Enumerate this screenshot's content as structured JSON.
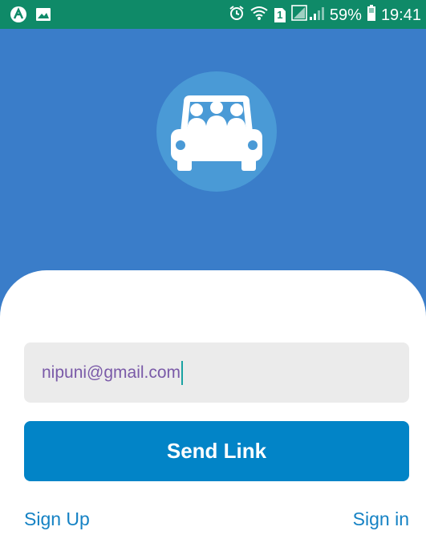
{
  "status_bar": {
    "battery_percent": "59%",
    "time": "19:41",
    "sim_label": "1",
    "icons": [
      "app-icon",
      "image-icon",
      "alarm-icon",
      "wifi-icon",
      "sim-icon",
      "signal-icon",
      "battery-icon"
    ]
  },
  "logo": {
    "icon": "carpool-car-icon"
  },
  "form": {
    "email_value": "nipuni@gmail.com",
    "send_label": "Send Link"
  },
  "links": {
    "sign_up": "Sign Up",
    "sign_in": "Sign in"
  },
  "colors": {
    "status_bar": "#0f8a68",
    "header_bg": "#3a7dc9",
    "logo_circle": "#4a9ad6",
    "button": "#0284c7",
    "link": "#1582c4",
    "input_text": "#7a5aa8"
  }
}
